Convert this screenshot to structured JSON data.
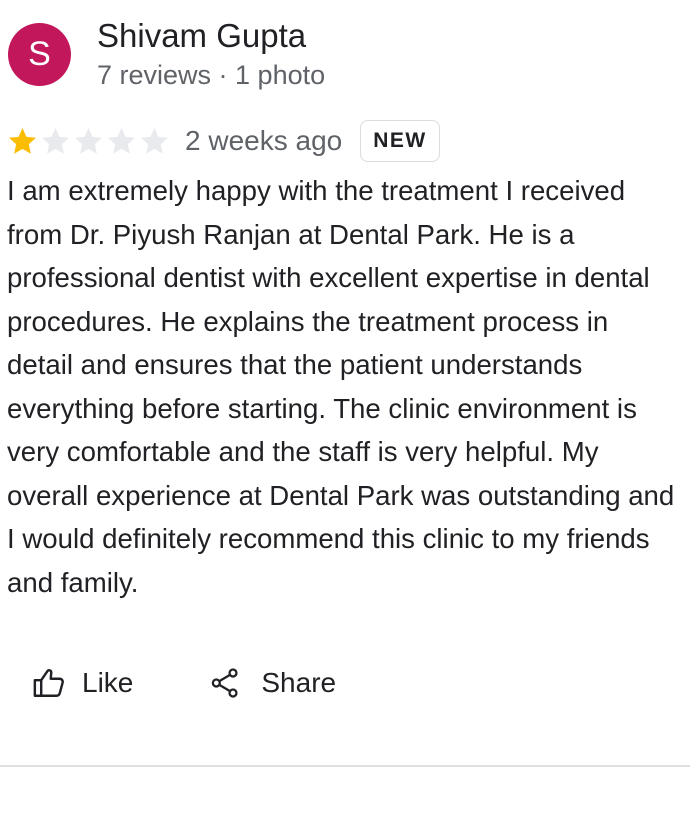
{
  "review": {
    "author": {
      "initial": "S",
      "name": "Shivam Gupta",
      "meta": "7 reviews · 1 photo",
      "avatar_color": "#c2185b"
    },
    "rating": 1,
    "rating_max": 5,
    "time": "2 weeks ago",
    "badge": "NEW",
    "text": "I am extremely happy with the treatment I received\nfrom Dr. Piyush Ranjan at Dental Park. He is a\nprofessional dentist with excellent expertise in dental\nprocedures. He explains the treatment process in\ndetail and ensures that the patient understands\neverything before starting. The clinic environment is\nvery comfortable and the staff is very helpful. My\noverall experience at Dental Park was outstanding and\nI would definitely recommend this clinic to my friends\nand family."
  },
  "actions": {
    "like_label": "Like",
    "like_icon": "thumbs-up-icon",
    "share_label": "Share",
    "share_icon": "share-icon"
  },
  "colors": {
    "star_filled": "#fbbc04",
    "star_empty": "#e8eaed",
    "text_primary": "#202124",
    "text_secondary": "#5f6368",
    "divider": "#e0e0e0"
  }
}
